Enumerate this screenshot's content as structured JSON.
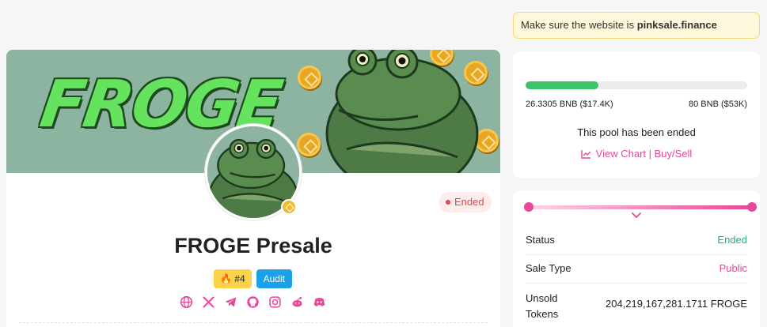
{
  "notice": {
    "prefix": "Make sure the website is ",
    "domain": "pinksale.finance"
  },
  "banner": {
    "text": "FROGE"
  },
  "project": {
    "title": "FROGE Presale",
    "status": "Ended",
    "rank_tag": "🔥 #4",
    "audit_tag": "Audit",
    "socials": [
      "globe-icon",
      "x-icon",
      "telegram-icon",
      "github-icon",
      "instagram-icon",
      "reddit-icon",
      "discord-icon"
    ]
  },
  "progress": {
    "fraction": 0.33,
    "raised": "26.3305 BNB ($17.4K)",
    "hardcap": "80 BNB ($53K)",
    "ended_message": "This pool has been ended",
    "chart_link": "View Chart | Buy/Sell"
  },
  "sale_info": {
    "rows": [
      {
        "label": "Status",
        "value": "Ended"
      },
      {
        "label": "Sale Type",
        "value": "Public"
      },
      {
        "label": "Unsold Tokens",
        "value": "204,219,167,281.1711 FROGE"
      }
    ]
  },
  "colors": {
    "pink": "#e9479a",
    "green": "#3cc46b",
    "teal": "#1fae83",
    "red": "#e04848",
    "banner_bg": "#8db3a1",
    "audit_blue": "#1aa1e8"
  }
}
